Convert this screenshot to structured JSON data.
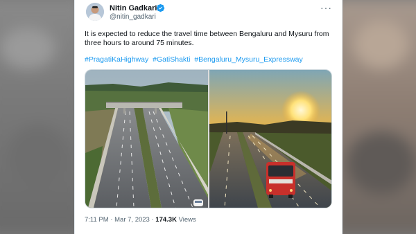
{
  "author": {
    "name": "Nitin Gadkari",
    "handle": "@nitin_gadkari",
    "verified": true
  },
  "tweet": {
    "text": "It is expected to reduce the travel time between Bengaluru and Mysuru from three hours to around 75 minutes.",
    "hashtags": [
      "#PragatiKaHighway",
      "#GatiShakti",
      "#Bengaluru_Mysuru_Expressway"
    ]
  },
  "meta": {
    "time": "7:11 PM",
    "separator": "·",
    "date": "Mar 7, 2023",
    "views_count": "174.3K",
    "views_label": "Views"
  },
  "icons": {
    "more": "more-icon",
    "verified": "verified-badge-icon"
  },
  "colors": {
    "link": "#1d9bf0",
    "text": "#0f1419",
    "muted": "#536471"
  }
}
